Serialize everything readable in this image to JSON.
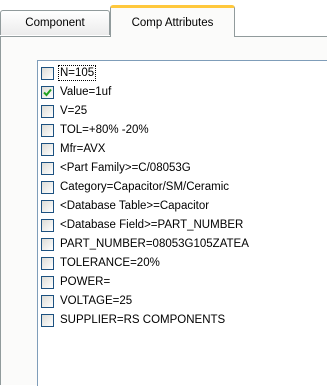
{
  "tabs": [
    {
      "label": "Component",
      "active": false
    },
    {
      "label": "Comp Attributes",
      "active": true
    }
  ],
  "attributes": [
    {
      "label": "N=105",
      "checked": false,
      "focused": true
    },
    {
      "label": "Value=1uf",
      "checked": true
    },
    {
      "label": "V=25",
      "checked": false
    },
    {
      "label": "TOL=+80% -20%",
      "checked": false
    },
    {
      "label": "Mfr=AVX",
      "checked": false
    },
    {
      "label": "<Part Family>=C/08053G",
      "checked": false
    },
    {
      "label": "Category=Capacitor/SM/Ceramic",
      "checked": false
    },
    {
      "label": "<Database Table>=Capacitor",
      "checked": false
    },
    {
      "label": "<Database Field>=PART_NUMBER",
      "checked": false
    },
    {
      "label": "PART_NUMBER=08053G105ZATEA",
      "checked": false
    },
    {
      "label": "TOLERANCE=20%",
      "checked": false
    },
    {
      "label": "POWER=",
      "checked": false
    },
    {
      "label": "VOLTAGE=25",
      "checked": false
    },
    {
      "label": "SUPPLIER=RS COMPONENTS",
      "checked": false
    }
  ],
  "colors": {
    "active_tab_highlight": "#ffc83c",
    "checkbox_border": "#1c5180",
    "check_mark": "#21a121"
  }
}
